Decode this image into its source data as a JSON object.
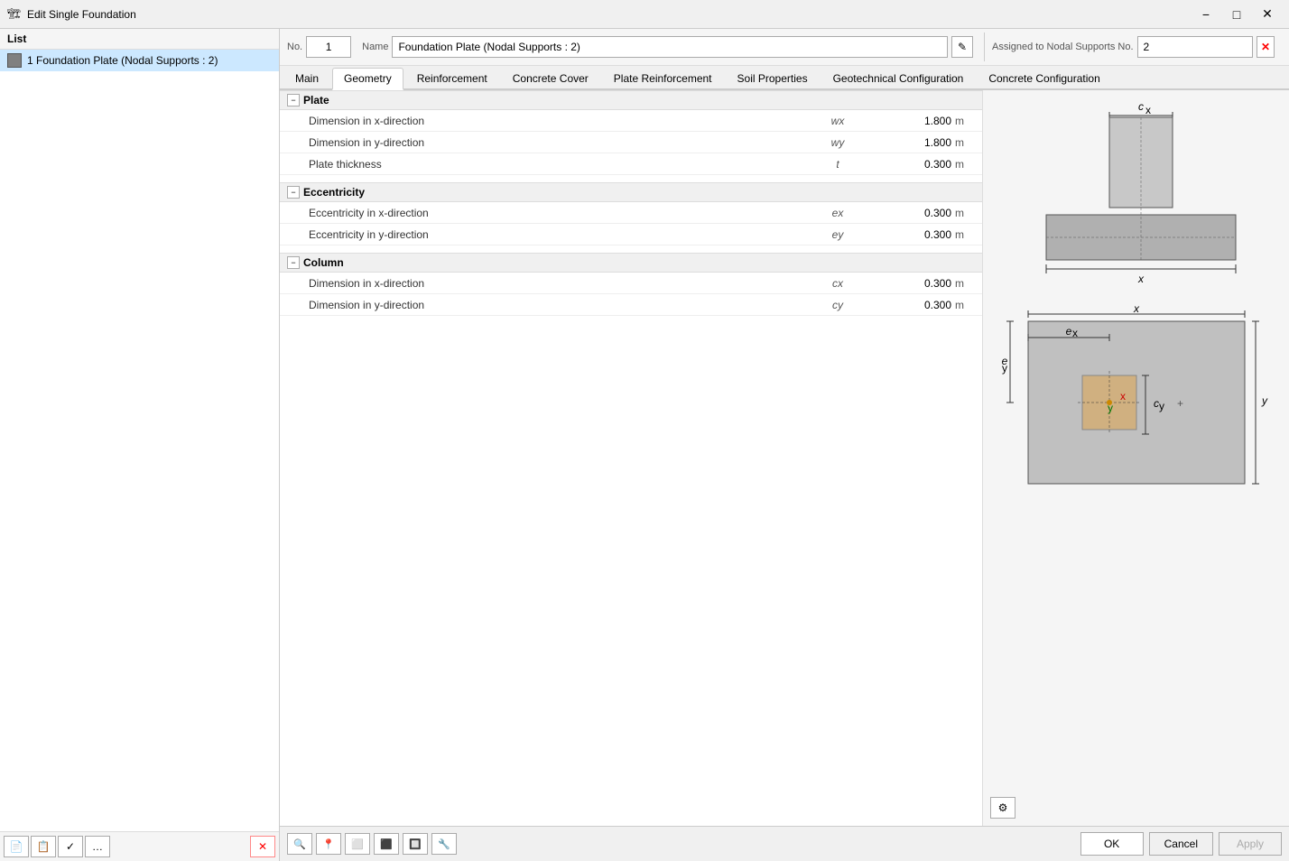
{
  "titleBar": {
    "icon": "🏗",
    "title": "Edit Single Foundation",
    "minimizeLabel": "−",
    "maximizeLabel": "□",
    "closeLabel": "✕"
  },
  "listPanel": {
    "header": "List",
    "items": [
      {
        "id": 1,
        "label": "1  Foundation Plate (Nodal Supports : 2)",
        "selected": true
      }
    ],
    "toolbar": {
      "newBtn": "📄",
      "copyBtn": "📋",
      "checkBtn": "✓",
      "moreBtn": "…",
      "deleteBtn": "✕"
    }
  },
  "header": {
    "noLabel": "No.",
    "noValue": "1",
    "nameLabel": "Name",
    "nameValue": "Foundation Plate (Nodal Supports : 2)",
    "editIcon": "✎",
    "assignedLabel": "Assigned to Nodal Supports No.",
    "assignedValue": "2",
    "clearBtn": "✕"
  },
  "tabs": [
    {
      "id": "main",
      "label": "Main",
      "active": false
    },
    {
      "id": "geometry",
      "label": "Geometry",
      "active": true
    },
    {
      "id": "reinforcement",
      "label": "Reinforcement",
      "active": false
    },
    {
      "id": "concreteCover",
      "label": "Concrete Cover",
      "active": false
    },
    {
      "id": "plateReinforcement",
      "label": "Plate Reinforcement",
      "active": false
    },
    {
      "id": "soilProperties",
      "label": "Soil Properties",
      "active": false
    },
    {
      "id": "geotechnicalConfig",
      "label": "Geotechnical Configuration",
      "active": false
    },
    {
      "id": "concreteConfig",
      "label": "Concrete Configuration",
      "active": false
    }
  ],
  "geometry": {
    "sections": [
      {
        "id": "plate",
        "label": "Plate",
        "rows": [
          {
            "label": "Dimension in x-direction",
            "symbol": "wx",
            "value": "1.800",
            "unit": "m"
          },
          {
            "label": "Dimension in y-direction",
            "symbol": "wy",
            "value": "1.800",
            "unit": "m"
          },
          {
            "label": "Plate thickness",
            "symbol": "t",
            "value": "0.300",
            "unit": "m"
          }
        ]
      },
      {
        "id": "eccentricity",
        "label": "Eccentricity",
        "rows": [
          {
            "label": "Eccentricity in x-direction",
            "symbol": "ex",
            "value": "0.300",
            "unit": "m"
          },
          {
            "label": "Eccentricity in y-direction",
            "symbol": "ey",
            "value": "0.300",
            "unit": "m"
          }
        ]
      },
      {
        "id": "column",
        "label": "Column",
        "rows": [
          {
            "label": "Dimension in x-direction",
            "symbol": "cx",
            "value": "0.300",
            "unit": "m"
          },
          {
            "label": "Dimension in y-direction",
            "symbol": "cy",
            "value": "0.300",
            "unit": "m"
          }
        ]
      }
    ]
  },
  "bottomBar": {
    "tools": [
      "🔍",
      "📍",
      "⬜",
      "⬛",
      "🔲",
      "🔧"
    ],
    "okLabel": "OK",
    "cancelLabel": "Cancel",
    "applyLabel": "Apply"
  }
}
